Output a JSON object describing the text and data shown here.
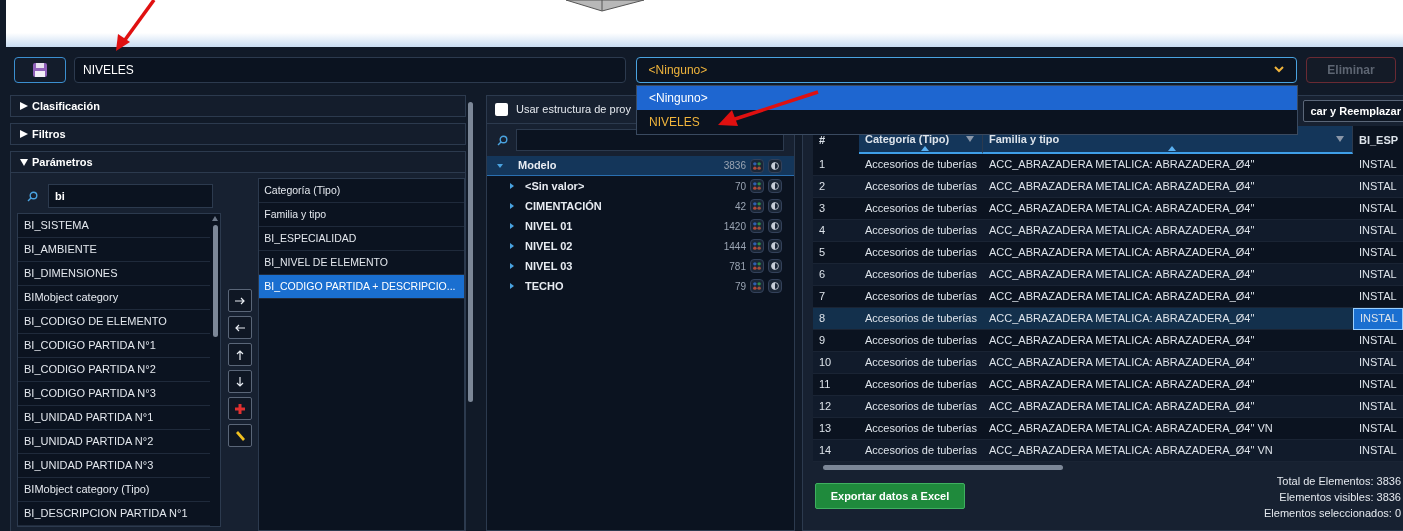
{
  "toolbar": {
    "name_field": {
      "value": "NIVELES"
    },
    "template_select": {
      "value": "<Ninguno>",
      "expanded": true,
      "options": [
        {
          "label": "<Ninguno>",
          "selected": true
        },
        {
          "label": "NIVELES",
          "selected": false
        }
      ]
    },
    "delete_button": {
      "label": "Eliminar",
      "disabled": true
    }
  },
  "sections": [
    {
      "label": "Clasificación",
      "expanded": false
    },
    {
      "label": "Filtros",
      "expanded": false
    },
    {
      "label": "Parámetros",
      "expanded": true
    }
  ],
  "parameters": {
    "search": {
      "value": "bi"
    },
    "available": [
      "BI_SISTEMA",
      "BI_AMBIENTE",
      "BI_DIMENSIONES",
      "BIMobject category",
      "BI_CODIGO DE ELEMENTO",
      "BI_CODIGO PARTIDA N°1",
      "BI_CODIGO PARTIDA N°2",
      "BI_CODIGO PARTIDA N°3",
      "BI_UNIDAD PARTIDA N°1",
      "BI_UNIDAD PARTIDA N°2",
      "BI_UNIDAD PARTIDA N°3",
      "BIMobject category (Tipo)",
      "BI_DESCRIPCION PARTIDA N°1"
    ],
    "chosen": [
      {
        "label": "Categoría (Tipo)",
        "selected": false
      },
      {
        "label": "Familia y tipo",
        "selected": false
      },
      {
        "label": "BI_ESPECIALIDAD",
        "selected": false
      },
      {
        "label": "BI_NIVEL DE ELEMENTO",
        "selected": false
      },
      {
        "label": "BI_CODIGO PARTIDA + DESCRIPCIO...",
        "selected": true
      }
    ]
  },
  "tree_panel": {
    "use_structure": {
      "label": "Usar estructura de proy",
      "checked": false
    },
    "tree": [
      {
        "label": "Modelo",
        "count": "3836",
        "expanded": true,
        "selected": true,
        "children": [
          {
            "label": "<Sin valor>",
            "count": "70",
            "expanded": false,
            "selected": false
          },
          {
            "label": "CIMENTACIÓN",
            "count": "42",
            "expanded": false,
            "selected": false
          },
          {
            "label": "NIVEL 01",
            "count": "1420",
            "expanded": false,
            "selected": false
          },
          {
            "label": "NIVEL 02",
            "count": "1444",
            "expanded": false,
            "selected": false
          },
          {
            "label": "NIVEL 03",
            "count": "781",
            "expanded": false,
            "selected": false
          },
          {
            "label": "TECHO",
            "count": "79",
            "expanded": false,
            "selected": false
          }
        ]
      }
    ]
  },
  "table": {
    "replace_button": "car y Reemplazar",
    "columns": [
      "#",
      "Categoría (Tipo)",
      "Familia y tipo",
      "BI_ESP"
    ],
    "rows": [
      {
        "cells": [
          "1",
          "Accesorios de tuberías",
          "ACC_ABRAZADERA METALICA: ABRAZADERA_Ø4\"",
          "INSTAL"
        ],
        "selected": false
      },
      {
        "cells": [
          "2",
          "Accesorios de tuberías",
          "ACC_ABRAZADERA METALICA: ABRAZADERA_Ø4\"",
          "INSTAL"
        ],
        "selected": false
      },
      {
        "cells": [
          "3",
          "Accesorios de tuberías",
          "ACC_ABRAZADERA METALICA: ABRAZADERA_Ø4\"",
          "INSTAL"
        ],
        "selected": false
      },
      {
        "cells": [
          "4",
          "Accesorios de tuberías",
          "ACC_ABRAZADERA METALICA: ABRAZADERA_Ø4\"",
          "INSTAL"
        ],
        "selected": false
      },
      {
        "cells": [
          "5",
          "Accesorios de tuberías",
          "ACC_ABRAZADERA METALICA: ABRAZADERA_Ø4\"",
          "INSTAL"
        ],
        "selected": false
      },
      {
        "cells": [
          "6",
          "Accesorios de tuberías",
          "ACC_ABRAZADERA METALICA: ABRAZADERA_Ø4\"",
          "INSTAL"
        ],
        "selected": false
      },
      {
        "cells": [
          "7",
          "Accesorios de tuberías",
          "ACC_ABRAZADERA METALICA: ABRAZADERA_Ø4\"",
          "INSTAL"
        ],
        "selected": false
      },
      {
        "cells": [
          "8",
          "Accesorios de tuberías",
          "ACC_ABRAZADERA METALICA: ABRAZADERA_Ø4\"",
          "INSTAL"
        ],
        "selected": true
      },
      {
        "cells": [
          "9",
          "Accesorios de tuberías",
          "ACC_ABRAZADERA METALICA: ABRAZADERA_Ø4\"",
          "INSTAL"
        ],
        "selected": false
      },
      {
        "cells": [
          "10",
          "Accesorios de tuberías",
          "ACC_ABRAZADERA METALICA: ABRAZADERA_Ø4\"",
          "INSTAL"
        ],
        "selected": false
      },
      {
        "cells": [
          "11",
          "Accesorios de tuberías",
          "ACC_ABRAZADERA METALICA: ABRAZADERA_Ø4\"",
          "INSTAL"
        ],
        "selected": false
      },
      {
        "cells": [
          "12",
          "Accesorios de tuberías",
          "ACC_ABRAZADERA METALICA: ABRAZADERA_Ø4\"",
          "INSTAL"
        ],
        "selected": false
      },
      {
        "cells": [
          "13",
          "Accesorios de tuberías",
          "ACC_ABRAZADERA METALICA: ABRAZADERA_Ø4\" VN",
          "INSTAL"
        ],
        "selected": false
      },
      {
        "cells": [
          "14",
          "Accesorios de tuberías",
          "ACC_ABRAZADERA METALICA: ABRAZADERA_Ø4\" VN",
          "INSTAL"
        ],
        "selected": false
      }
    ],
    "export_button": "Exportar datos a Excel",
    "stats": [
      "Total de Elementos: 3836",
      "Elementos visibles: 3836",
      "Elementos seleccionados: 0"
    ]
  }
}
